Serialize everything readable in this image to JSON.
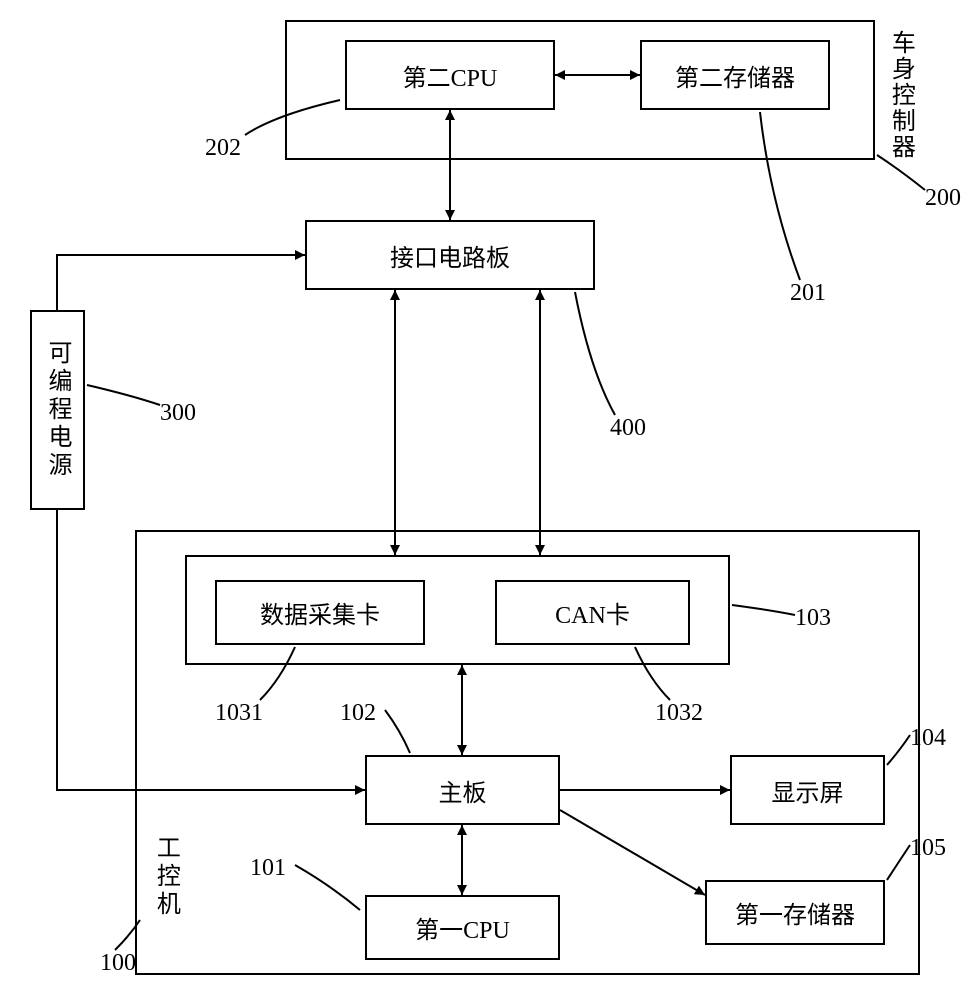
{
  "blocks": {
    "cpu2": "第二CPU",
    "mem2": "第二存储器",
    "interface_board": "接口电路板",
    "power": "可编程电源",
    "daq_card": "数据采集卡",
    "can_card": "CAN卡",
    "mainboard": "主板",
    "cpu1": "第一CPU",
    "display": "显示屏",
    "mem1": "第一存储器"
  },
  "labels": {
    "body_controller": "车身控制器",
    "ipc": "工控机"
  },
  "refs": {
    "r100": "100",
    "r101": "101",
    "r102": "102",
    "r103": "103",
    "r104": "104",
    "r105": "105",
    "r200": "200",
    "r201": "201",
    "r202": "202",
    "r300": "300",
    "r400": "400",
    "r1031": "1031",
    "r1032": "1032"
  }
}
